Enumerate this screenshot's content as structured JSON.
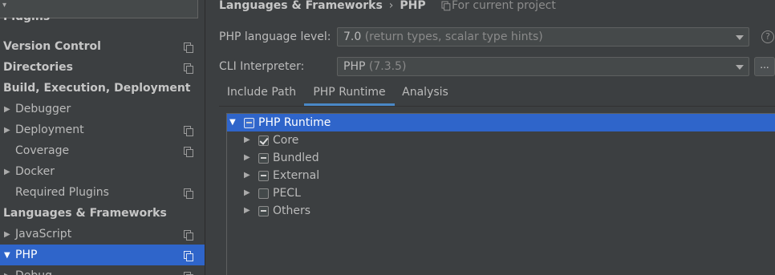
{
  "sidebar": {
    "partial_top_label": "Plugins",
    "items": [
      {
        "label": "Version Control",
        "bold": true,
        "arrow": "",
        "project_icon": true
      },
      {
        "label": "Directories",
        "bold": true,
        "arrow": "",
        "project_icon": true
      },
      {
        "label": "Build, Execution, Deployment",
        "bold": true,
        "arrow": "",
        "project_icon": false
      },
      {
        "label": "Debugger",
        "bold": false,
        "arrow": "▶",
        "project_icon": false
      },
      {
        "label": "Deployment",
        "bold": false,
        "arrow": "▶",
        "project_icon": true
      },
      {
        "label": "Coverage",
        "bold": false,
        "arrow": "",
        "project_icon": true
      },
      {
        "label": "Docker",
        "bold": false,
        "arrow": "▶",
        "project_icon": false
      },
      {
        "label": "Required Plugins",
        "bold": false,
        "arrow": "",
        "project_icon": true
      },
      {
        "label": "Languages & Frameworks",
        "bold": true,
        "arrow": "",
        "project_icon": false
      },
      {
        "label": "JavaScript",
        "bold": false,
        "arrow": "▶",
        "project_icon": true
      },
      {
        "label": "PHP",
        "bold": false,
        "arrow": "▼",
        "project_icon": true,
        "selected": true
      },
      {
        "label": "Debug",
        "bold": false,
        "arrow": "▶",
        "project_icon": true
      }
    ]
  },
  "header": {
    "breadcrumb_parent": "Languages & Frameworks",
    "breadcrumb_sep": "›",
    "breadcrumb_current": "PHP",
    "scope_note": "For current project"
  },
  "form": {
    "language_level_label": "PHP language level:",
    "language_level_value": "7.0",
    "language_level_hint": "(return types, scalar type hints)",
    "cli_label": "CLI Interpreter:",
    "cli_value": "PHP",
    "cli_version": "(7.3.5)",
    "help_glyph": "?",
    "more_glyph": "..."
  },
  "tabs": [
    {
      "label": "Include Path",
      "active": false
    },
    {
      "label": "PHP Runtime",
      "active": true
    },
    {
      "label": "Analysis",
      "active": false
    }
  ],
  "runtime_tree": [
    {
      "label": "PHP Runtime",
      "arrow": "▼",
      "state": "partial",
      "level": 0,
      "selected": true
    },
    {
      "label": "Core",
      "arrow": "▶",
      "state": "checked",
      "level": 1,
      "selected": false
    },
    {
      "label": "Bundled",
      "arrow": "▶",
      "state": "partial",
      "level": 1,
      "selected": false
    },
    {
      "label": "External",
      "arrow": "▶",
      "state": "partial",
      "level": 1,
      "selected": false
    },
    {
      "label": "PECL",
      "arrow": "▶",
      "state": "unchecked",
      "level": 1,
      "selected": false
    },
    {
      "label": "Others",
      "arrow": "▶",
      "state": "partial",
      "level": 1,
      "selected": false
    }
  ],
  "colors": {
    "selection": "#2f65ca",
    "background": "#3c3f41",
    "active_tab_underline": "#4a88c7"
  }
}
